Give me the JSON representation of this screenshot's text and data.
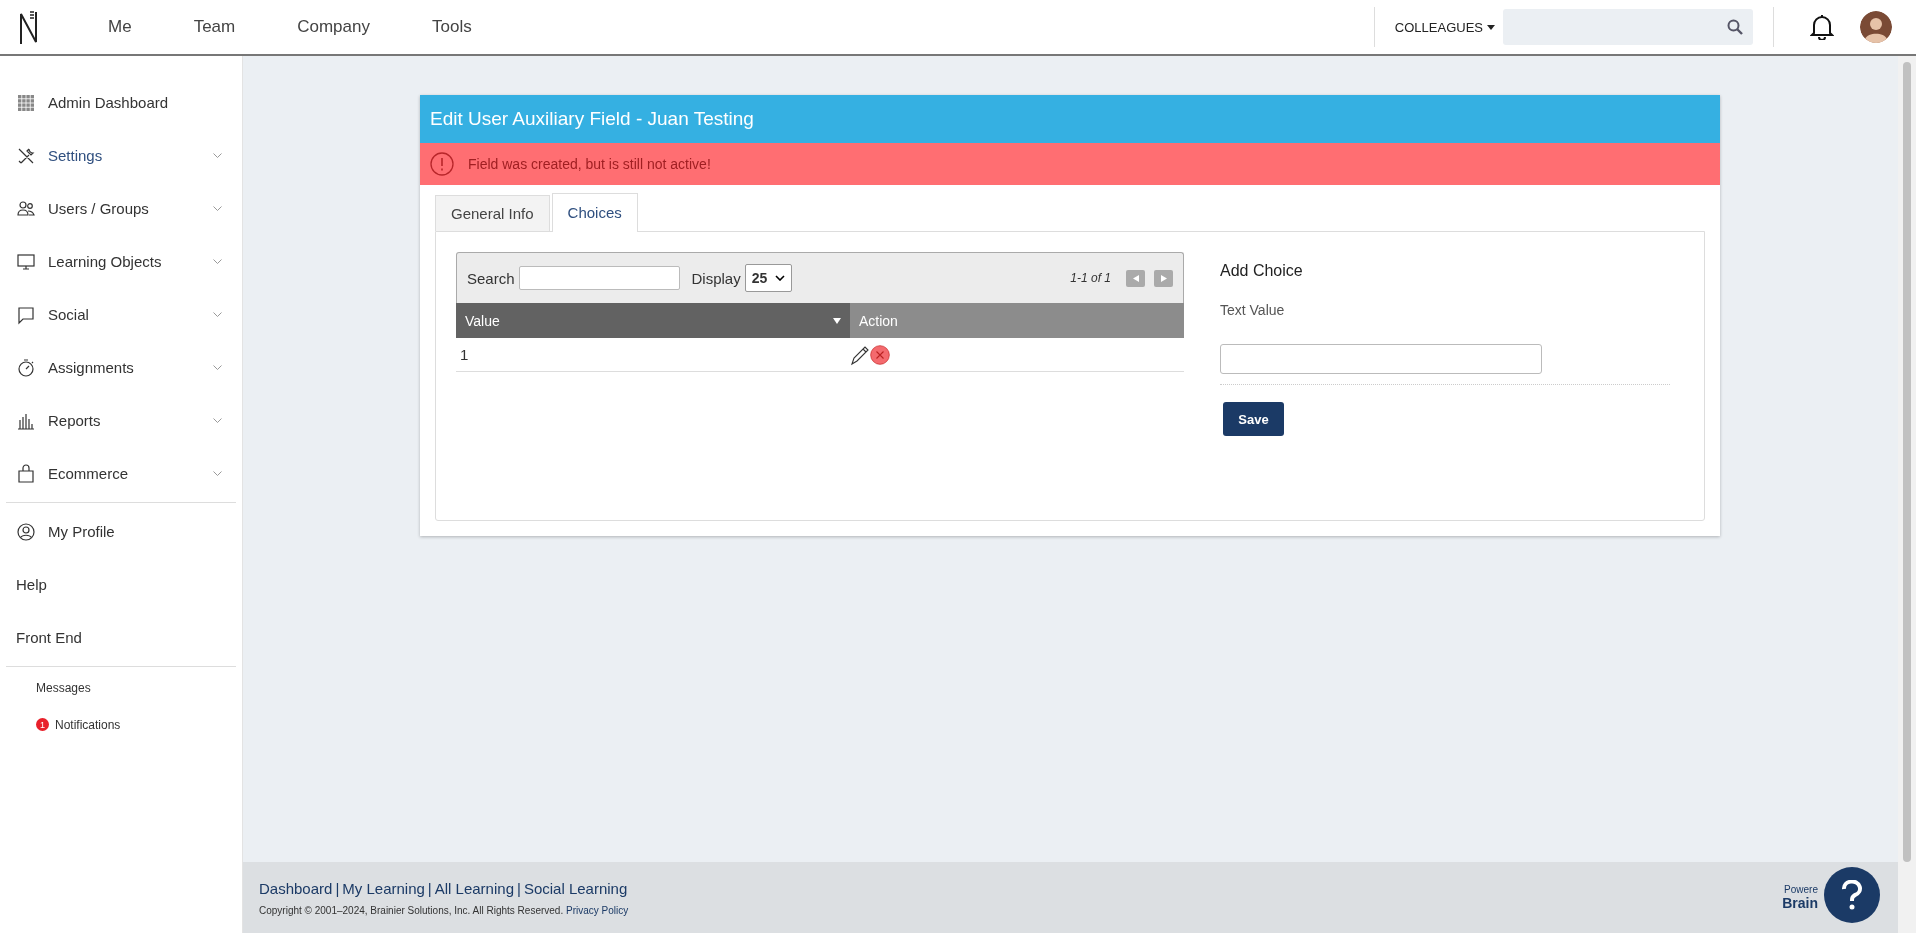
{
  "topbar": {
    "nav": [
      {
        "label": "Me"
      },
      {
        "label": "Team"
      },
      {
        "label": "Company"
      },
      {
        "label": "Tools"
      }
    ],
    "colleagues": "COLLEAGUES"
  },
  "sidebar": {
    "items": [
      {
        "label": "Admin Dashboard",
        "kind": "menu",
        "expandable": false,
        "selected": false
      },
      {
        "label": "Settings",
        "kind": "menu",
        "expandable": true,
        "selected": true
      },
      {
        "label": "Users / Groups",
        "kind": "menu",
        "expandable": true,
        "selected": false
      },
      {
        "label": "Learning Objects",
        "kind": "menu",
        "expandable": true,
        "selected": false
      },
      {
        "label": "Social",
        "kind": "menu",
        "expandable": true,
        "selected": false
      },
      {
        "label": "Assignments",
        "kind": "menu",
        "expandable": true,
        "selected": false
      },
      {
        "label": "Reports",
        "kind": "menu",
        "expandable": true,
        "selected": false
      },
      {
        "label": "Ecommerce",
        "kind": "menu",
        "expandable": true,
        "selected": false
      },
      {
        "kind": "divider"
      },
      {
        "label": "My Profile",
        "kind": "menu",
        "expandable": false,
        "selected": false
      },
      {
        "label": "Help",
        "kind": "plain"
      },
      {
        "label": "Front End",
        "kind": "plain"
      },
      {
        "kind": "divider"
      },
      {
        "label": "Messages",
        "kind": "small"
      },
      {
        "label": "Notifications",
        "kind": "small",
        "badge": "1"
      }
    ]
  },
  "panel": {
    "title": "Edit User Auxiliary Field - Juan Testing",
    "alert": "Field was created, but is still not active!",
    "tabs": [
      {
        "label": "General Info",
        "selected": false
      },
      {
        "label": "Choices",
        "selected": true
      }
    ],
    "table": {
      "search_label": "Search",
      "display_label": "Display",
      "display_value": "25",
      "pager": "1-1 of 1",
      "columns": [
        "Value",
        "Action"
      ],
      "rows": [
        {
          "value": "1"
        }
      ]
    },
    "form": {
      "title": "Add Choice",
      "field_label": "Text Value",
      "button": "Save"
    }
  },
  "footer": {
    "links": [
      "Dashboard",
      "My Learning",
      "All Learning",
      "Social Learning"
    ],
    "separator": "|",
    "copyright": "Copyright © 2001–2024, Brainier Solutions, Inc. All Rights Reserved.",
    "privacy": "Privacy Policy",
    "powered": "Powere",
    "brand": "Brain"
  }
}
